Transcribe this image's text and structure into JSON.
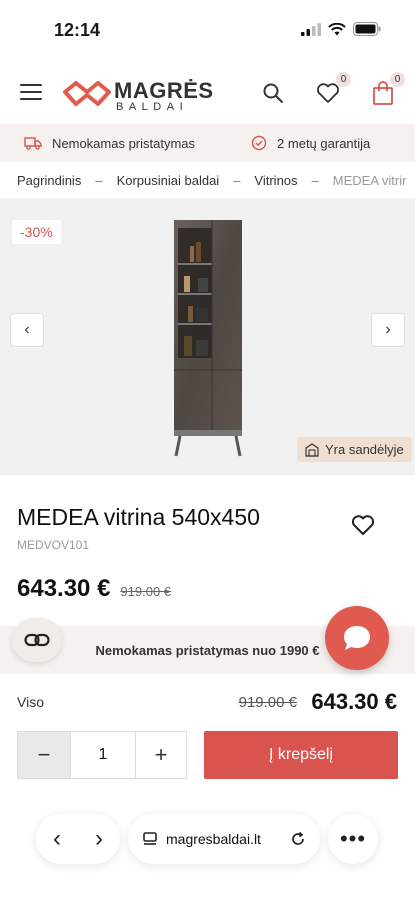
{
  "status": {
    "time": "12:14"
  },
  "header": {
    "logo_brand": "MAGRĖS",
    "logo_sub": "BALDAI",
    "wishlist_count": "0",
    "cart_count": "0"
  },
  "infobar": {
    "delivery_label": "Nemokamas pristatymas",
    "warranty_label": "2 metų garantija"
  },
  "breadcrumb": {
    "items": [
      "Pagrindinis",
      "Korpusiniai baldai",
      "Vitrinos"
    ],
    "current": "MEDEA vitrir"
  },
  "gallery": {
    "discount": "-30%",
    "stock_label": "Yra sandėlyje"
  },
  "product": {
    "title": "MEDEA vitrina 540x450",
    "sku": "MEDVOV101",
    "price_new": "643.30 €",
    "price_old": "919.00 €"
  },
  "shipping": {
    "text": "Nemokamas pristatymas nuo 1990 €"
  },
  "total": {
    "label": "Viso",
    "old": "919.00 €",
    "new": "643.30 €"
  },
  "cart": {
    "qty_minus": "−",
    "qty_value": "1",
    "qty_plus": "+",
    "add_label": "Į krepšelį"
  },
  "browser": {
    "url": "magresbaldai.lt"
  },
  "colors": {
    "accent": "#d9534f",
    "chat": "#e05a4f",
    "bar_bg": "#f6f1ee"
  }
}
